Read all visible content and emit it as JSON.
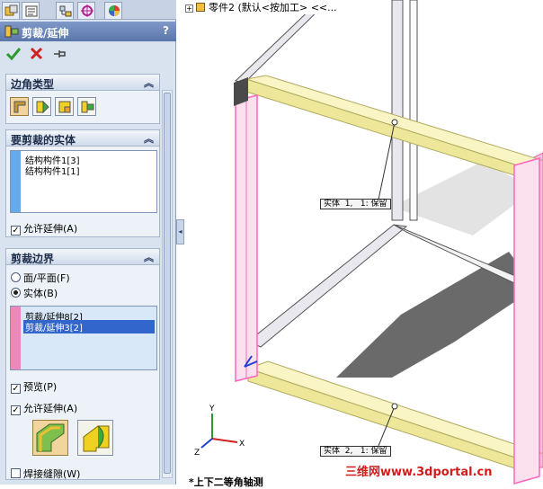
{
  "panel": {
    "title": "剪裁/延伸",
    "help": "?",
    "groups": {
      "corner": {
        "title": "边角类型",
        "active_index": 0
      },
      "bodies": {
        "title": "要剪裁的实体",
        "items": [
          "结构构件1[3]",
          "结构构件1[1]"
        ],
        "allow_extend": "允许延伸(A)"
      },
      "boundary": {
        "title": "剪裁边界",
        "radio_face": "面/平面(F)",
        "radio_body": "实体(B)",
        "selected_radio": "body",
        "items": [
          "剪裁/延伸8[2]",
          "剪裁/延伸3[2]"
        ],
        "selected_item": 1,
        "preview": "预览(P)",
        "allow_extend": "允许延伸(A)",
        "weld_gap": "焊接缝隙(W)"
      }
    },
    "colors": {
      "bodies_strip": "#66aaee",
      "boundary_strip": "#ee88bb",
      "title_bar": "#6a86ba"
    }
  },
  "graphics": {
    "tree_path": "零件2 (默认<按加工> <<...",
    "callout_top": "实体  1,   1: 保留",
    "callout_bottom": "实体  2,   1: 保留",
    "view_label": "*上下二等角轴测",
    "watermark": "三维网www.3dportal.cn",
    "triad": {
      "x": "X",
      "y": "Y",
      "z": "Z"
    },
    "colors": {
      "member": "#f5f0b8",
      "highlight": "#ff88cc",
      "shadow": "#444444"
    }
  }
}
